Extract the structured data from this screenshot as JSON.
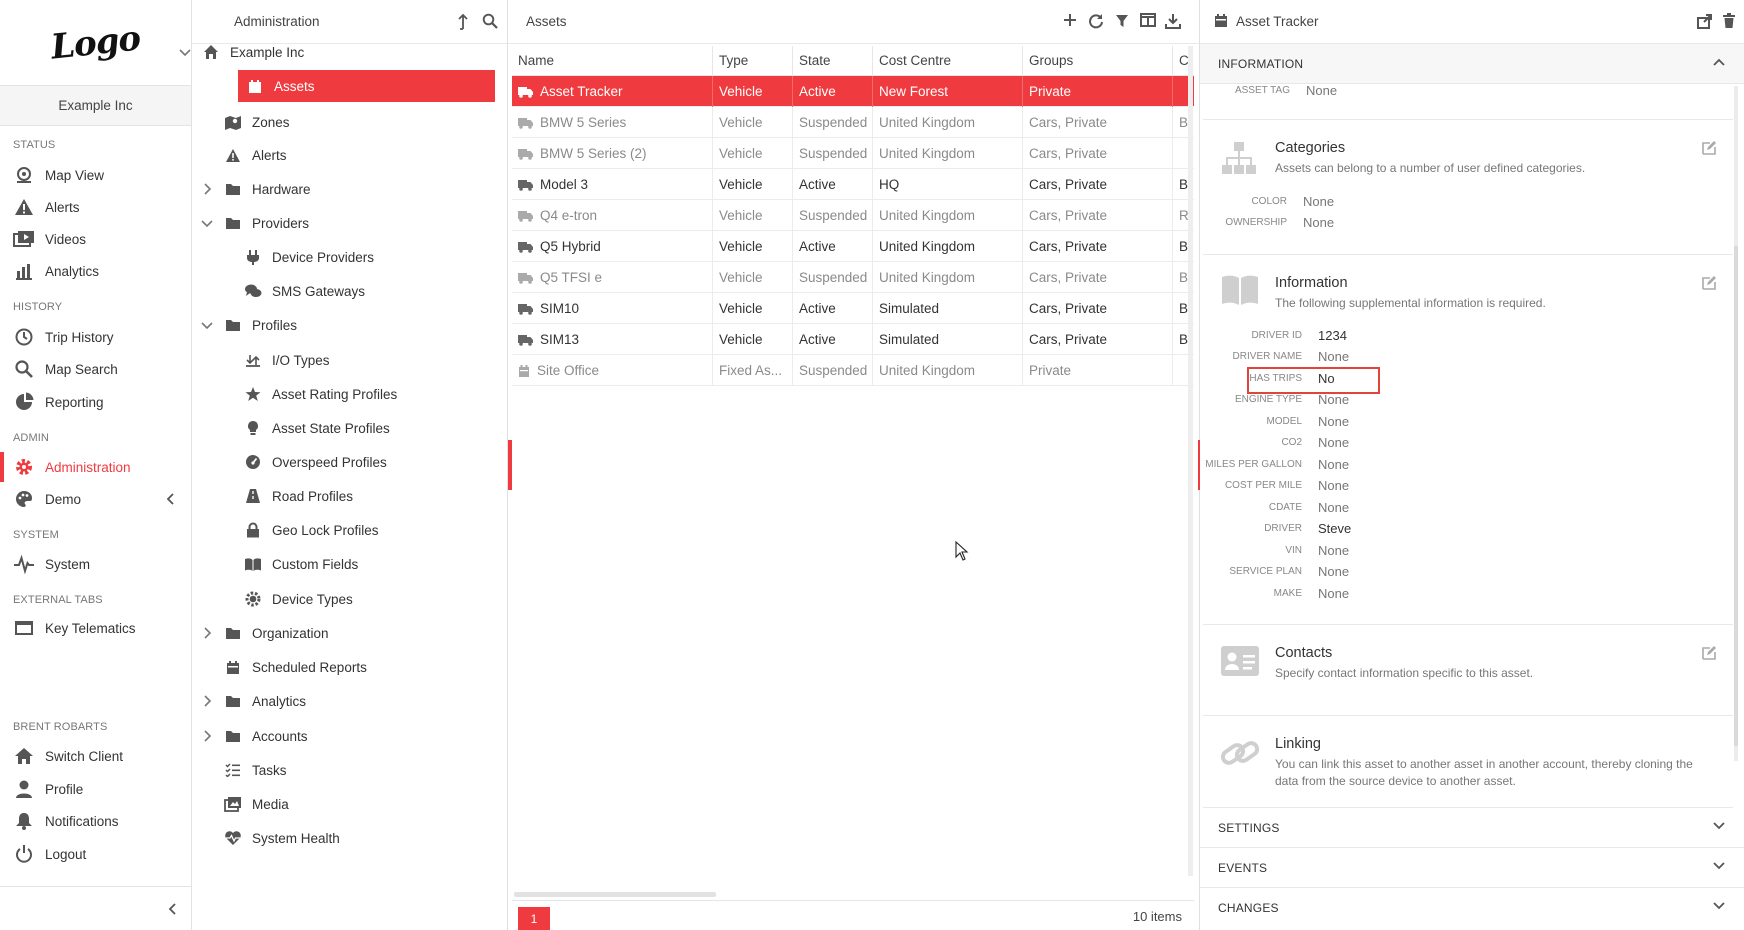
{
  "brand": {
    "logo_text": "Logo",
    "client_name": "Example Inc",
    "accent": "#ef3b3f"
  },
  "nav": {
    "sections": {
      "status": "STATUS",
      "history": "HISTORY",
      "admin": "ADMIN",
      "system": "SYSTEM",
      "external": "EXTERNAL TABS",
      "user": "BRENT ROBARTS"
    },
    "items": {
      "map_view": "Map View",
      "alerts": "Alerts",
      "videos": "Videos",
      "analytics": "Analytics",
      "trip_history": "Trip History",
      "map_search": "Map Search",
      "reporting": "Reporting",
      "administration": "Administration",
      "demo": "Demo",
      "system": "System",
      "key_telematics": "Key Telematics",
      "switch_client": "Switch Client",
      "profile": "Profile",
      "notifications": "Notifications",
      "logout": "Logout"
    }
  },
  "admin_tree": {
    "title": "Administration",
    "root": "Example Inc",
    "items": {
      "assets": "Assets",
      "zones": "Zones",
      "alerts": "Alerts",
      "hardware": "Hardware",
      "providers": "Providers",
      "device_providers": "Device Providers",
      "sms_gateways": "SMS Gateways",
      "profiles": "Profiles",
      "io_types": "I/O Types",
      "asset_rating_profiles": "Asset Rating Profiles",
      "asset_state_profiles": "Asset State Profiles",
      "overspeed_profiles": "Overspeed Profiles",
      "road_profiles": "Road Profiles",
      "geo_lock_profiles": "Geo Lock Profiles",
      "custom_fields": "Custom Fields",
      "device_types": "Device Types",
      "organization": "Organization",
      "scheduled_reports": "Scheduled Reports",
      "analytics": "Analytics",
      "accounts": "Accounts",
      "tasks": "Tasks",
      "media": "Media",
      "system_health": "System Health"
    }
  },
  "assets": {
    "title": "Assets",
    "columns": [
      "Name",
      "Type",
      "State",
      "Cost Centre",
      "Groups",
      "C"
    ],
    "rows": [
      {
        "name": "Asset Tracker",
        "type": "Vehicle",
        "state": "Active",
        "cost": "New Forest",
        "groups": "Private",
        "extra": ""
      },
      {
        "name": "BMW 5 Series",
        "type": "Vehicle",
        "state": "Suspended",
        "cost": "United Kingdom",
        "groups": "Cars, Private",
        "extra": "B"
      },
      {
        "name": "BMW 5 Series (2)",
        "type": "Vehicle",
        "state": "Suspended",
        "cost": "United Kingdom",
        "groups": "Cars, Private",
        "extra": ""
      },
      {
        "name": "Model 3",
        "type": "Vehicle",
        "state": "Active",
        "cost": "HQ",
        "groups": "Cars, Private",
        "extra": "B"
      },
      {
        "name": "Q4 e-tron",
        "type": "Vehicle",
        "state": "Suspended",
        "cost": "United Kingdom",
        "groups": "Cars, Private",
        "extra": "R"
      },
      {
        "name": "Q5 Hybrid",
        "type": "Vehicle",
        "state": "Active",
        "cost": "United Kingdom",
        "groups": "Cars, Private",
        "extra": "B"
      },
      {
        "name": "Q5 TFSI e",
        "type": "Vehicle",
        "state": "Suspended",
        "cost": "United Kingdom",
        "groups": "Cars, Private",
        "extra": "B"
      },
      {
        "name": "SIM10",
        "type": "Vehicle",
        "state": "Active",
        "cost": "Simulated",
        "groups": "Cars, Private",
        "extra": "B"
      },
      {
        "name": "SIM13",
        "type": "Vehicle",
        "state": "Active",
        "cost": "Simulated",
        "groups": "Cars, Private",
        "extra": "B"
      },
      {
        "name": "Site Office",
        "type": "Fixed As...",
        "state": "Suspended",
        "cost": "United Kingdom",
        "groups": "Private",
        "extra": ""
      }
    ],
    "page": "1",
    "count": "10 items"
  },
  "detail": {
    "title": "Asset Tracker",
    "section_info": "INFORMATION",
    "asset_tag_label": "ASSET TAG",
    "asset_tag_value": "None",
    "categories": {
      "title": "Categories",
      "desc": "Assets can belong to a number of user defined categories.",
      "fields": [
        {
          "k": "COLOR",
          "v": "None"
        },
        {
          "k": "OWNERSHIP",
          "v": "None"
        }
      ]
    },
    "information": {
      "title": "Information",
      "desc": "The following supplemental information is required.",
      "fields": [
        {
          "k": "DRIVER ID",
          "v": "1234"
        },
        {
          "k": "DRIVER NAME",
          "v": "None"
        },
        {
          "k": "HAS TRIPS",
          "v": "No"
        },
        {
          "k": "ENGINE TYPE",
          "v": "None"
        },
        {
          "k": "MODEL",
          "v": "None"
        },
        {
          "k": "CO2",
          "v": "None"
        },
        {
          "k": "MILES PER GALLON",
          "v": "None"
        },
        {
          "k": "COST PER MILE",
          "v": "None"
        },
        {
          "k": "CDATE",
          "v": "None"
        },
        {
          "k": "DRIVER",
          "v": "Steve"
        },
        {
          "k": "VIN",
          "v": "None"
        },
        {
          "k": "SERVICE PLAN",
          "v": "None"
        },
        {
          "k": "MAKE",
          "v": "None"
        }
      ]
    },
    "contacts": {
      "title": "Contacts",
      "desc": "Specify contact information specific to this asset."
    },
    "linking": {
      "title": "Linking",
      "desc": "You can link this asset to another asset in another account, thereby cloning the data from the source device to another asset."
    },
    "sections": {
      "settings": "SETTINGS",
      "events": "EVENTS",
      "changes": "CHANGES"
    }
  }
}
